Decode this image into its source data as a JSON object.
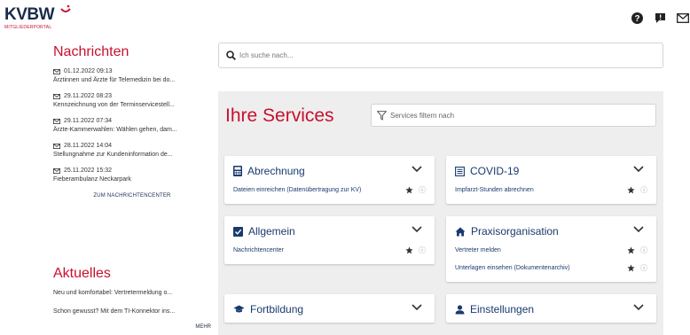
{
  "header": {
    "logo_text": "KVBW",
    "logo_subtitle": "MITGLIEDERPORTAL",
    "brand_color": "#c8102e",
    "icons": [
      "help-icon",
      "feedback-icon",
      "mail-icon"
    ]
  },
  "news": {
    "title": "Nachrichten",
    "items": [
      {
        "date": "01.12.2022 09:13",
        "text": "Ärztinnen und Ärzte für Telemedizin bei do..."
      },
      {
        "date": "29.11.2022 08:23",
        "text": "Kennzeichnung von der Terminservicestell..."
      },
      {
        "date": "29.11.2022 07:34",
        "text": "Ärzte-Kammerwahlen: Wählen gehen, dam..."
      },
      {
        "date": "28.11.2022 14:04",
        "text": "Stellungnahme zur Kundeninformation de..."
      },
      {
        "date": "25.11.2022 15:32",
        "text": "Fieberambulanz Neckarpark"
      }
    ],
    "center_link": "ZUM NACHRICHTENCENTER"
  },
  "aktuelles": {
    "title": "Aktuelles",
    "items": [
      "Neu und komfortabel: Vertretermeldung o...",
      "Schon gewusst? Mit dem TI-Konnektor ins..."
    ],
    "more_link": "MEHR"
  },
  "search": {
    "placeholder": "Ich suche nach..."
  },
  "services": {
    "title": "Ihre Services",
    "filter_placeholder": "Services filtern nach",
    "cards": [
      {
        "title": "Abrechnung",
        "icon": "calculator-icon",
        "links": [
          "Dateien einreichen (Datenübertragung zur KV)"
        ]
      },
      {
        "title": "COVID-19",
        "icon": "document-icon",
        "links": [
          "Impfarzt-Stunden abrechnen"
        ]
      },
      {
        "title": "Allgemein",
        "icon": "checkbox-icon",
        "links": [
          "Nachrichtencenter"
        ]
      },
      {
        "title": "Praxisorganisation",
        "icon": "home-icon",
        "links": [
          "Vertreter melden",
          "Unterlagen einsehen (Dokumentenarchiv)"
        ]
      },
      {
        "title": "Fortbildung",
        "icon": "graduation-cap-icon",
        "links": []
      },
      {
        "title": "Einstellungen",
        "icon": "user-icon",
        "links": []
      }
    ]
  },
  "info_glyph": "ⓘ"
}
